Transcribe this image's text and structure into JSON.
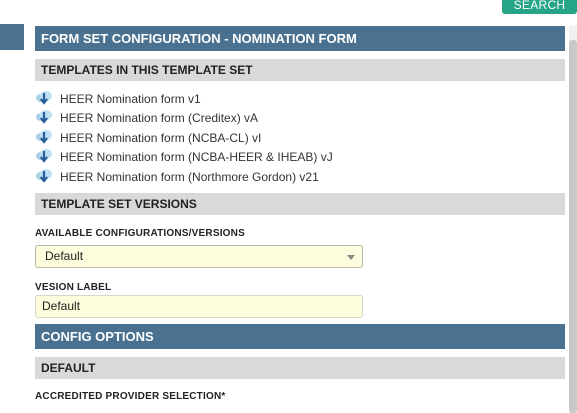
{
  "top_button": {
    "label": "SEARCH"
  },
  "panel": {
    "title": "FORM SET CONFIGURATION - NOMINATION FORM",
    "templates_section": {
      "title": "TEMPLATES IN THIS TEMPLATE SET",
      "items": [
        {
          "icon": "cloud-download-icon",
          "label": "HEER Nomination form v1"
        },
        {
          "icon": "cloud-download-icon",
          "label": "HEER Nomination form (Creditex) vA"
        },
        {
          "icon": "cloud-download-icon",
          "label": "HEER Nomination form (NCBA-CL) vI"
        },
        {
          "icon": "cloud-download-icon",
          "label": "HEER Nomination form (NCBA-HEER & IHEAB) vJ"
        },
        {
          "icon": "cloud-download-icon",
          "label": "HEER Nomination form (Northmore Gordon) v21"
        }
      ]
    },
    "versions_section": {
      "title": "TEMPLATE SET VERSIONS",
      "available_label": "AVAILABLE CONFIGURATIONS/VERSIONS",
      "available_value": "Default",
      "version_label_label": "VESION LABEL",
      "version_label_value": "Default"
    },
    "config_section": {
      "title": "CONFIG OPTIONS",
      "subsection_title": "DEFAULT",
      "field_label": "ACCREDITED PROVIDER SELECTION*"
    }
  },
  "colors": {
    "header_bg": "#4a7290",
    "subheader_bg": "#d9d9d9",
    "input_bg": "#fdfcdc",
    "button_bg": "#26a486"
  }
}
